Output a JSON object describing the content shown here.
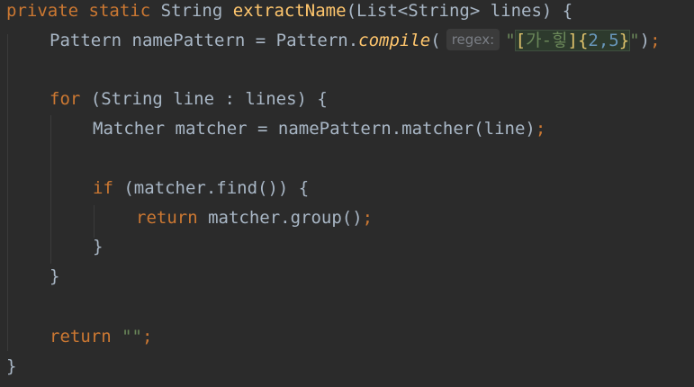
{
  "code": {
    "line1": {
      "kw_private": "private",
      "kw_static": "static",
      "type": "String",
      "method_name": "extractName",
      "params": "(List<String> lines) {"
    },
    "line2": {
      "decl": "Pattern namePattern = Pattern.",
      "method": "compile",
      "open_paren": "(",
      "hint": "regex:",
      "quote_open": "\"",
      "rx_open_bracket": "[",
      "rx_range": "가-힣",
      "rx_close_bracket": "]",
      "rx_open_brace": "{",
      "rx_nums": "2,5",
      "rx_close_brace": "}",
      "quote_close": "\"",
      "close": ")",
      "semi": ";"
    },
    "line3": {
      "kw_for": "for",
      "rest": " (String line : lines) {"
    },
    "line4": {
      "text": "Matcher matcher = namePattern.matcher(line)",
      "semi": ";"
    },
    "line5": {
      "kw_if": "if",
      "rest": " (matcher.find()) {"
    },
    "line6": {
      "kw_return": "return",
      "text": " matcher.group()",
      "semi": ";"
    },
    "line7": {
      "text": "}"
    },
    "line8": {
      "text": "}"
    },
    "line9": {
      "kw_return": "return",
      "str": " \"\"",
      "semi": ";"
    },
    "line10": {
      "text": "}"
    }
  }
}
